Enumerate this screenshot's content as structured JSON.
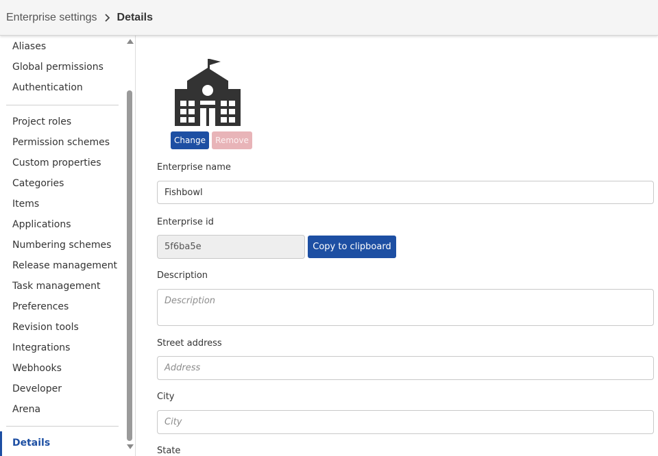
{
  "breadcrumb": {
    "parent": "Enterprise settings",
    "current": "Details"
  },
  "sidebar": {
    "group1": [
      "Aliases",
      "Global permissions",
      "Authentication"
    ],
    "group2": [
      "Project roles",
      "Permission schemes",
      "Custom properties",
      "Categories",
      "Items",
      "Applications",
      "Numbering schemes",
      "Release management",
      "Task management",
      "Preferences",
      "Revision tools",
      "Integrations",
      "Webhooks",
      "Developer",
      "Arena"
    ],
    "active": "Details"
  },
  "logo": {
    "icon": "school-building-icon"
  },
  "buttons": {
    "change": "Change",
    "remove": "Remove",
    "copy": "Copy to clipboard"
  },
  "form": {
    "enterprise_name": {
      "label": "Enterprise name",
      "value": "Fishbowl"
    },
    "enterprise_id": {
      "label": "Enterprise id",
      "value": "5f6ba5e"
    },
    "description": {
      "label": "Description",
      "placeholder": "Description"
    },
    "street": {
      "label": "Street address",
      "placeholder": "Address"
    },
    "city": {
      "label": "City",
      "placeholder": "City"
    },
    "state": {
      "label": "State"
    }
  },
  "colors": {
    "primary": "#1d4fa3",
    "remove_disabled": "#e8b4b8",
    "logo": "#333333"
  }
}
